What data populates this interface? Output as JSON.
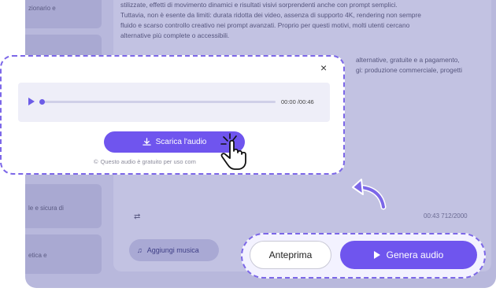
{
  "sidebar": {
    "items": [
      {
        "label": "zionario e"
      },
      {
        "label": ""
      },
      {
        "label": ""
      },
      {
        "label": "le e sicura di"
      },
      {
        "label": "etica e"
      }
    ]
  },
  "editor": {
    "paragraph_lines": [
      "stilizzate, effetti di movimento dinamici e risultati visivi sorprendenti anche con prompt semplici.",
      "Tuttavia, non è esente da limiti: durata ridotta dei video, assenza di supporto 4K, rendering non sempre",
      "fluido e scarso controllo creativo nei prompt avanzati. Proprio per questi motivi, molti utenti cercano",
      "alternative più complete o accessibili."
    ],
    "paragraph2_lines": [
      "alternative, gratuite e a pagamento,",
      "gi: produzione commerciale, progetti"
    ],
    "counter": "00:43    712/2000",
    "music_button": "Aggiungi musica"
  },
  "popup": {
    "close_label": "×",
    "player": {
      "time": "00:00 /00:46",
      "progress": 0.0
    },
    "download_button": "Scarica l'audio",
    "notice": "Questo audio è gratuito per uso com"
  },
  "actions": {
    "preview_button": "Anteprima",
    "generate_button": "Genera audio"
  },
  "colors": {
    "accent": "#6f55ee",
    "overlay": "#b8b8dc",
    "dash": "#7c67e8"
  }
}
